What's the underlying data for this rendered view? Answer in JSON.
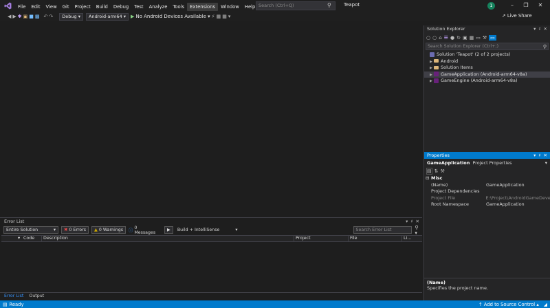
{
  "menu": [
    "File",
    "Edit",
    "View",
    "Git",
    "Project",
    "Build",
    "Debug",
    "Test",
    "Analyze",
    "Tools",
    "Extensions",
    "Window",
    "Help"
  ],
  "search": {
    "placeholder": "Search (Ctrl+Q)"
  },
  "solution_name": "Teapot",
  "user_initial": "1",
  "live_share": "Live Share",
  "toolbar": {
    "config": "Debug",
    "platform": "Android-arm64",
    "device": "No Android Devices Available"
  },
  "solution_explorer": {
    "title": "Solution Explorer",
    "search_placeholder": "Search Solution Explorer (Ctrl+;)",
    "solution": "Solution 'Teapot' (2 of 2 projects)",
    "items": [
      {
        "label": "Android",
        "kind": "folder"
      },
      {
        "label": "Solution Items",
        "kind": "folder"
      },
      {
        "label": "GameApplication (Android-arm64-v8a)",
        "kind": "project",
        "selected": true
      },
      {
        "label": "GameEngine (Android-arm64-v8a)",
        "kind": "project"
      }
    ]
  },
  "properties": {
    "title": "Properties",
    "object": "GameApplication",
    "object_type": "Project Properties",
    "category": "Misc",
    "rows": [
      {
        "name": "(Name)",
        "value": "GameApplication"
      },
      {
        "name": "Project Dependencies",
        "value": ""
      },
      {
        "name": "Project File",
        "value": "E:\\Project\\AndroidGameDevelop"
      },
      {
        "name": "Root Namespace",
        "value": "GameApplication"
      }
    ],
    "desc_title": "(Name)",
    "desc_text": "Specifies the project name."
  },
  "error_list": {
    "title": "Error List",
    "scope": "Entire Solution",
    "errors": "0 Errors",
    "warnings": "0 Warnings",
    "messages": "0 Messages",
    "build_filter": "Build + IntelliSense",
    "search_placeholder": "Search Error List",
    "columns": {
      "code": "Code",
      "description": "Description",
      "project": "Project",
      "file": "File",
      "line": "Li..."
    }
  },
  "bottom_tabs": [
    "Error List",
    "Output"
  ],
  "status": {
    "ready": "Ready",
    "source_control": "Add to Source Control"
  },
  "colors": {
    "accent": "#007acc",
    "background": "#1e1e1e"
  }
}
